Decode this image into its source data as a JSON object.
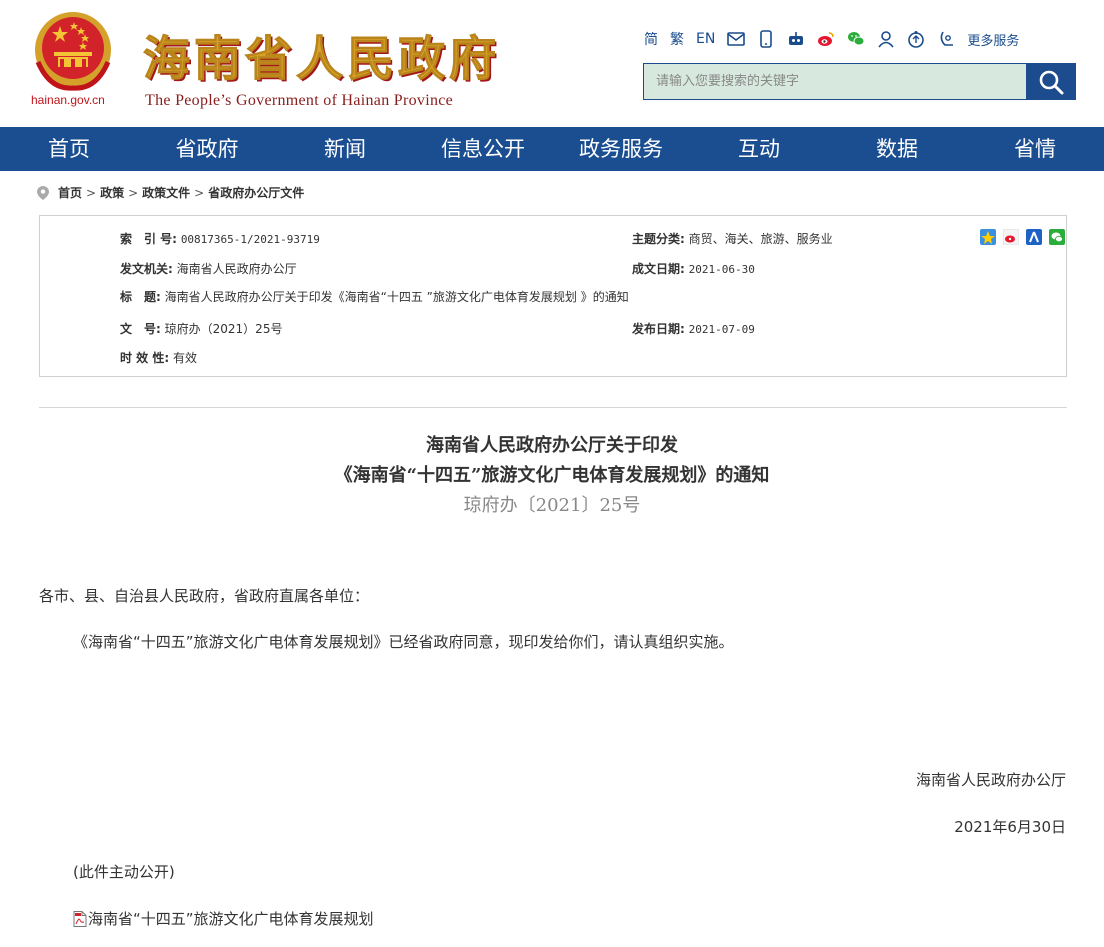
{
  "header": {
    "domain": "hainan.gov.cn",
    "title": "海南省人民政府",
    "subtitle": "The People’s Government  of Hainan Province",
    "lang_simplified": "简",
    "lang_traditional": "繁",
    "lang_english": "EN",
    "icons": [
      "mail-icon",
      "mobile-icon",
      "robot-icon",
      "weibo-icon",
      "wechat-icon",
      "user-icon",
      "accessibility-icon",
      "elderly-icon"
    ],
    "more_service": "更多服务",
    "search_placeholder": "请输入您要搜索的关键字"
  },
  "nav": {
    "items": [
      "首页",
      "省政府",
      "新闻",
      "信息公开",
      "政务服务",
      "互动",
      "数据",
      "省情"
    ]
  },
  "breadcrumb": {
    "items": [
      "首页",
      "政策",
      "政策文件",
      "省政府办公厅文件"
    ],
    "separator": ">"
  },
  "meta": {
    "index_label": "索　引 号:",
    "index_value": "00817365-1/2021-93719",
    "topic_label": "主题分类:",
    "topic_value": "商贸、海关、旅游、服务业",
    "issuer_label": "发文机关:",
    "issuer_value": "海南省人民政府办公厅",
    "written_label": "成文日期:",
    "written_value": "2021-06-30",
    "title_label": "标　题:",
    "title_value": "海南省人民政府办公厅关于印发《海南省“十四五 ”旅游文化广电体育发展规划 》的通知",
    "docno_label": "文　号:",
    "docno_value": "琼府办（2021）25号",
    "published_label": "发布日期:",
    "published_value": "2021-07-09",
    "validity_label": "时 效 性:",
    "validity_value": "有效"
  },
  "article": {
    "title_line1": "海南省人民政府办公厅关于印发",
    "title_line2": "《海南省“十四五”旅游文化广电体育发展规划》的通知",
    "doc_number": "琼府办〔2021〕25号",
    "salutation": "各市、县、自治县人民政府，省政府直属各单位：",
    "body": "《海南省“十四五”旅游文化广电体育发展规划》已经省政府同意，现印发给你们，请认真组织实施。",
    "signature": "海南省人民政府办公厅",
    "date": "2021年6月30日",
    "note": "(此件主动公开)",
    "attachment": "海南省“十四五”旅游文化广电体育发展规划"
  },
  "colors": {
    "nav_bg": "#1b4e91",
    "title_gold": "#d9a326",
    "title_red_shadow": "#a3161a",
    "search_bg": "#d7e9df"
  }
}
